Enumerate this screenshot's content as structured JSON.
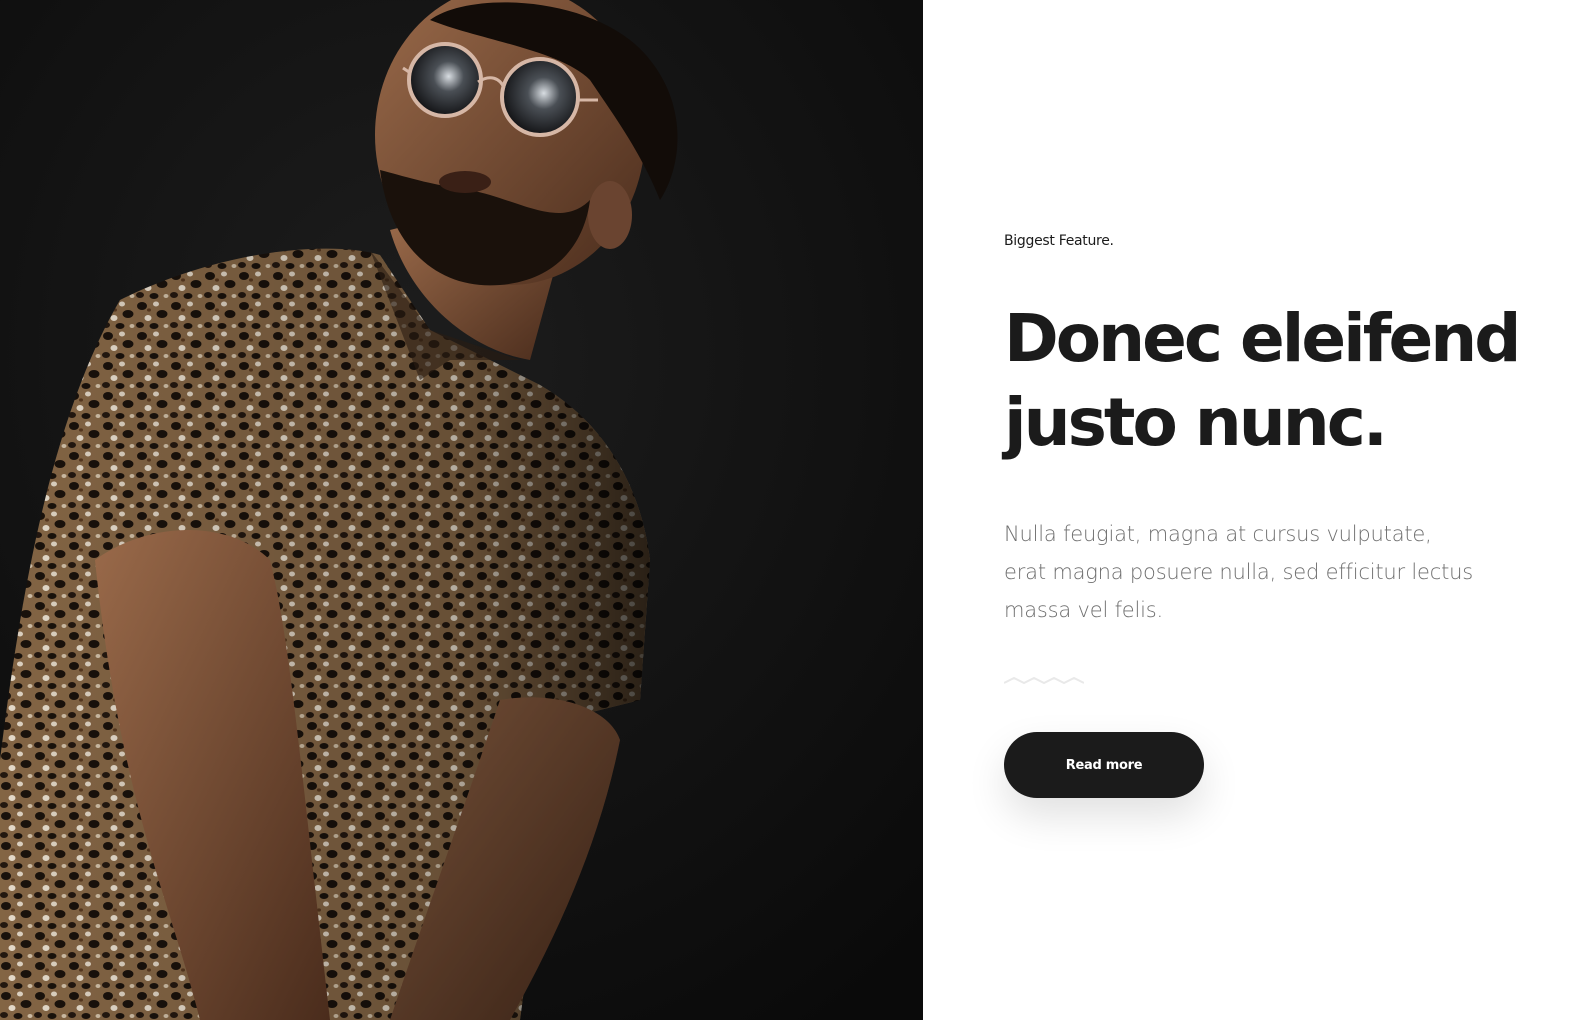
{
  "hero_image": {
    "subject": "man-in-leopard-shirt-with-sunglasses",
    "background_color": "#0d0d0d"
  },
  "feature": {
    "eyebrow": "Biggest Feature.",
    "headline_line1": "Donec eleifend",
    "headline_line2": "justo nunc.",
    "body": "Nulla feugiat, magna at cursus vulputate, erat magna posuere nulla, sed efficitur lectus massa vel felis.",
    "divider_icon": "wave-divider-icon",
    "button_label": "Read more"
  },
  "colors": {
    "text_dark": "#1b1b1b",
    "text_muted": "#6f6f6f",
    "button_bg": "#1b1b1b",
    "button_text": "#ffffff"
  }
}
